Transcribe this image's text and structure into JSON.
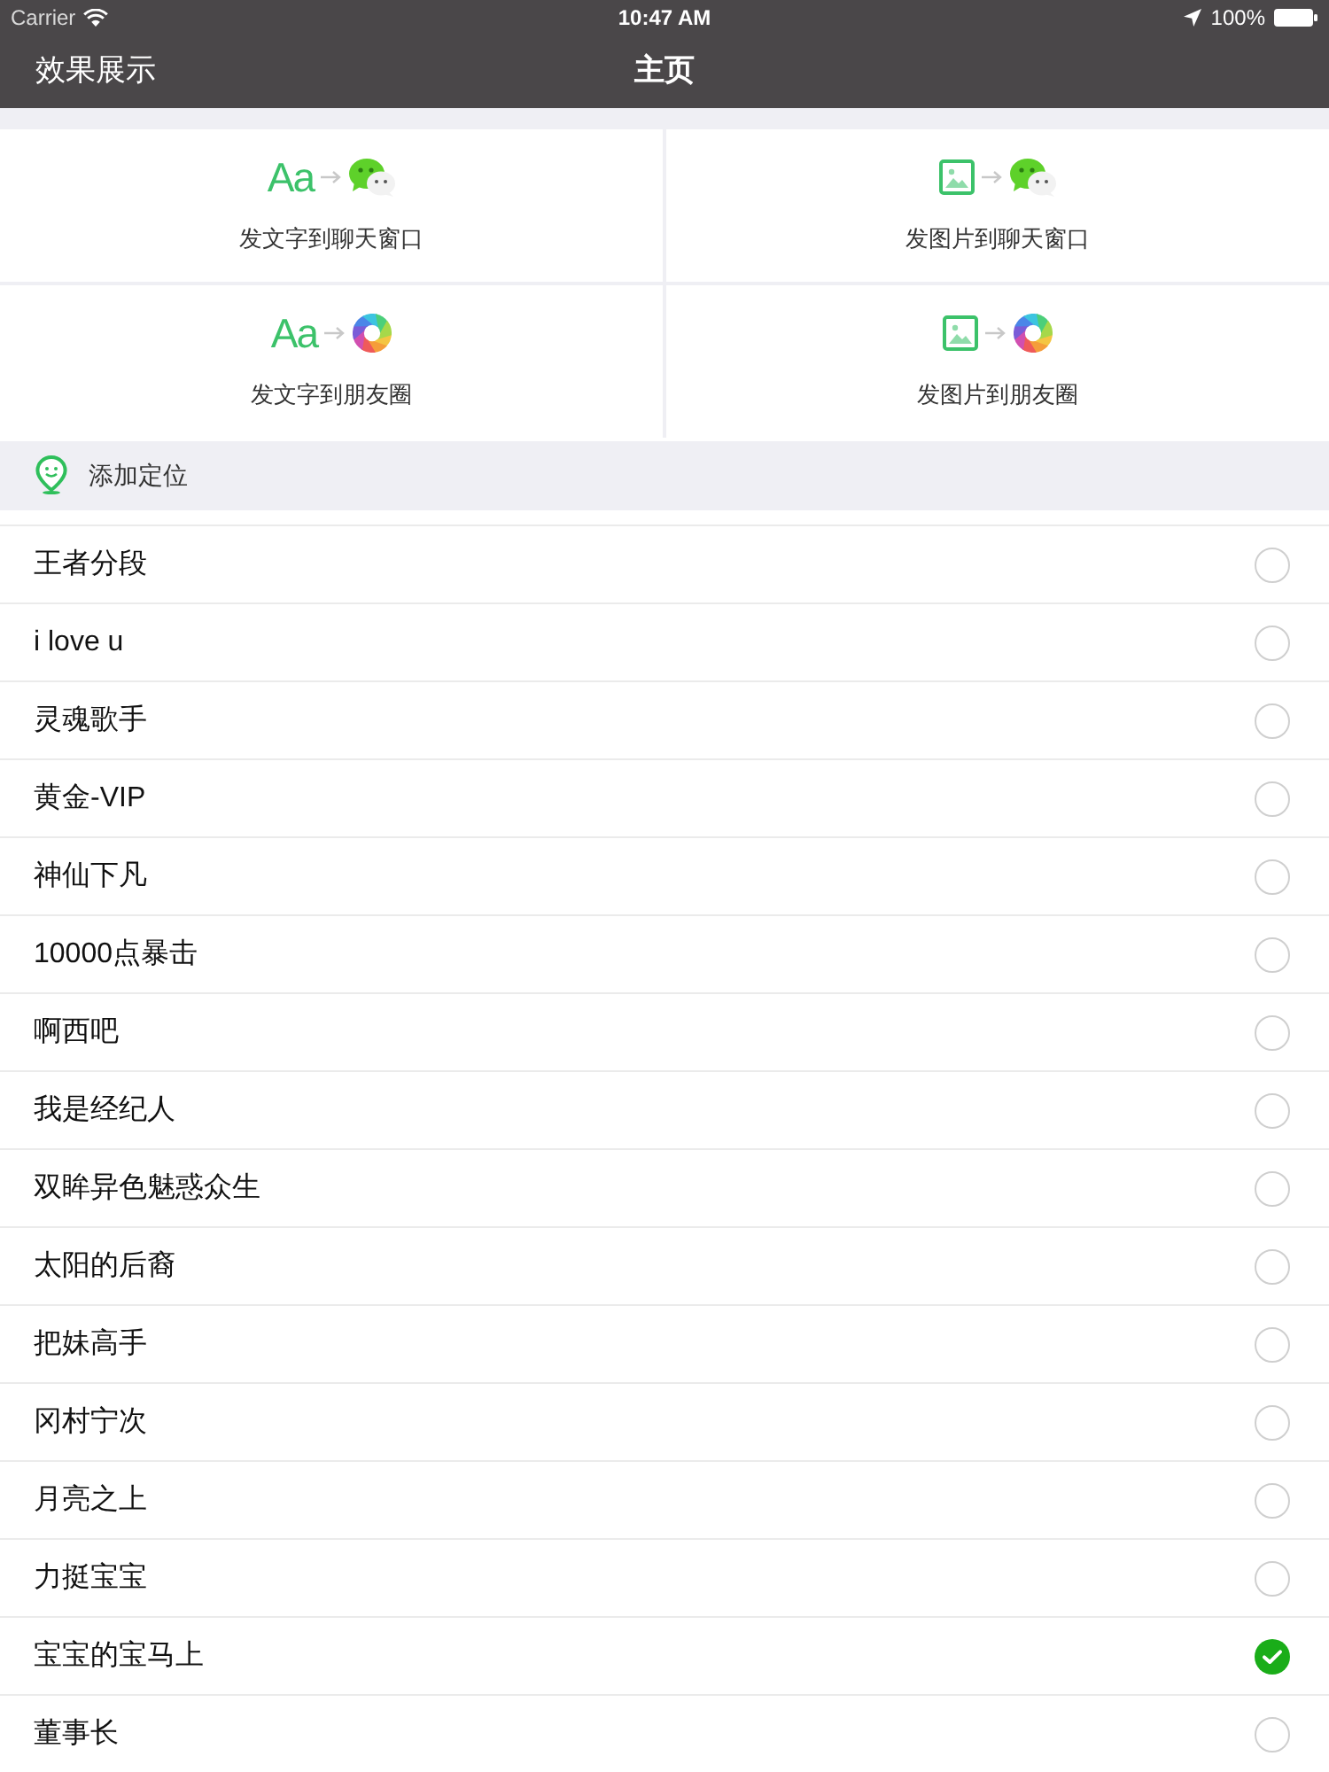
{
  "status_bar": {
    "carrier": "Carrier",
    "time": "10:47 AM",
    "battery": "100%"
  },
  "nav_bar": {
    "back_title": "效果展示",
    "title": "主页"
  },
  "share_tiles": [
    {
      "source": {
        "kind": "text",
        "glyph": "Aa"
      },
      "target": {
        "kind": "chat"
      },
      "label": "发文字到聊天窗口"
    },
    {
      "source": {
        "kind": "image"
      },
      "target": {
        "kind": "chat"
      },
      "label": "发图片到聊天窗口"
    },
    {
      "source": {
        "kind": "text",
        "glyph": "Aa"
      },
      "target": {
        "kind": "moments"
      },
      "label": "发文字到朋友圈"
    },
    {
      "source": {
        "kind": "image"
      },
      "target": {
        "kind": "moments"
      },
      "label": "发图片到朋友圈"
    }
  ],
  "location": {
    "label": "添加定位"
  },
  "options": [
    {
      "label": "王者分段",
      "selected": false
    },
    {
      "label": "i love u",
      "selected": false
    },
    {
      "label": "灵魂歌手",
      "selected": false
    },
    {
      "label": "黄金-VIP",
      "selected": false
    },
    {
      "label": "神仙下凡",
      "selected": false
    },
    {
      "label": "10000点暴击",
      "selected": false
    },
    {
      "label": "啊西吧",
      "selected": false
    },
    {
      "label": "我是经纪人",
      "selected": false
    },
    {
      "label": "双眸异色魅惑众生",
      "selected": false
    },
    {
      "label": "太阳的后裔",
      "selected": false
    },
    {
      "label": "把妹高手",
      "selected": false
    },
    {
      "label": "冈村宁次",
      "selected": false
    },
    {
      "label": "月亮之上",
      "selected": false
    },
    {
      "label": "力挺宝宝",
      "selected": false
    },
    {
      "label": "宝宝的宝马上",
      "selected": true
    },
    {
      "label": "董事长",
      "selected": false
    }
  ]
}
